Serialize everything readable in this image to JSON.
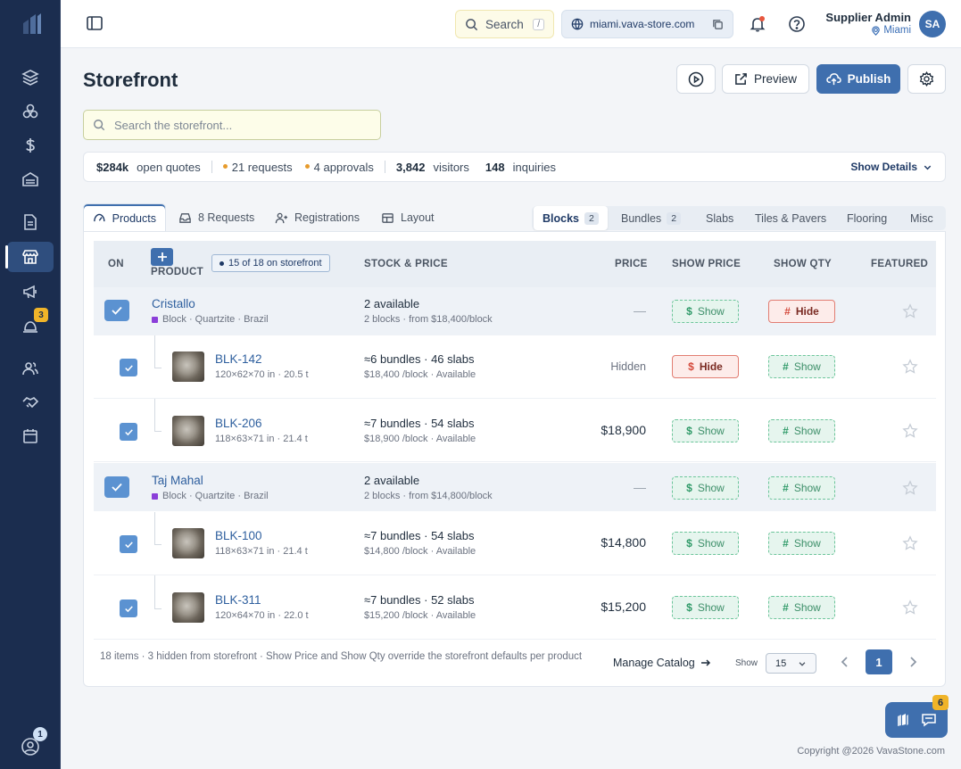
{
  "topbar": {
    "search_label": "Search",
    "search_shortcut": "/",
    "store_url": "miami.vava-store.com",
    "user_name": "Supplier Admin",
    "user_location": "Miami",
    "avatar_initials": "SA"
  },
  "sidebar": {
    "badge_campaigns": "3",
    "badge_profile": "1",
    "items": [
      "layers-icon",
      "boxes-icon",
      "dollar-icon",
      "warehouse-icon",
      "document-icon",
      "storefront-icon",
      "megaphone-icon",
      "bell-desk-icon",
      "users-icon",
      "handshake-icon",
      "calendar-icon"
    ]
  },
  "page": {
    "title": "Storefront",
    "preview_label": "Preview",
    "publish_label": "Publish",
    "search_placeholder": "Search the storefront..."
  },
  "stats": {
    "open_quotes_value": "$284k",
    "open_quotes_label": "open quotes",
    "requests": "21 requests",
    "approvals": "4 approvals",
    "visitors_value": "3,842",
    "visitors_label": "visitors",
    "inquiries_value": "148",
    "inquiries_label": "inquiries",
    "show_details": "Show Details"
  },
  "tabs": {
    "products": "Products",
    "requests": "8 Requests",
    "registrations": "Registrations",
    "layout": "Layout"
  },
  "subtabs": {
    "blocks": "Blocks",
    "blocks_count": "2",
    "bundles": "Bundles",
    "bundles_count": "2",
    "slabs": "Slabs",
    "tiles": "Tiles & Pavers",
    "flooring": "Flooring",
    "misc": "Misc"
  },
  "table": {
    "headers": {
      "on": "ON",
      "product": "PRODUCT",
      "on_storefront": "15 of 18 on storefront",
      "stock": "STOCK & PRICE",
      "price": "PRICE",
      "show_price": "SHOW PRICE",
      "show_qty": "SHOW QTY",
      "featured": "FEATURED"
    },
    "rows": [
      {
        "type": "parent",
        "name": "Cristallo",
        "meta": "Block · Quartzite · Brazil",
        "stock": "2 available",
        "stock_sub": "2 blocks · from $18,400/block",
        "price": "—",
        "show_price": "Show",
        "show_qty": "Hide"
      },
      {
        "type": "child",
        "name": "BLK-142",
        "dims": "120×62×70 in · 20.5 t",
        "stock": "≈6 bundles · 46 slabs",
        "stock_sub": "$18,400 /block · Available",
        "price": "Hidden",
        "show_price": "Hide",
        "show_qty": "Show"
      },
      {
        "type": "child",
        "name": "BLK-206",
        "dims": "118×63×71 in · 21.4 t",
        "stock": "≈7 bundles · 54 slabs",
        "stock_sub": "$18,900 /block · Available",
        "price": "$18,900",
        "show_price": "Show",
        "show_qty": "Show"
      },
      {
        "type": "parent",
        "name": "Taj Mahal",
        "meta": "Block · Quartzite · Brazil",
        "stock": "2 available",
        "stock_sub": "2 blocks · from $14,800/block",
        "price": "—",
        "show_price": "Show",
        "show_qty": "Show"
      },
      {
        "type": "child",
        "name": "BLK-100",
        "dims": "118×63×71 in · 21.4 t",
        "stock": "≈7 bundles · 54 slabs",
        "stock_sub": "$14,800 /block · Available",
        "price": "$14,800",
        "show_price": "Show",
        "show_qty": "Show"
      },
      {
        "type": "child",
        "name": "BLK-311",
        "dims": "120×64×70 in · 22.0 t",
        "stock": "≈7 bundles · 52 slabs",
        "stock_sub": "$15,200 /block · Available",
        "price": "$15,200",
        "show_price": "Show",
        "show_qty": "Show"
      }
    ]
  },
  "footer": {
    "note": "18 items · 3 hidden from storefront · Show Price and Show Qty override the storefront defaults per product",
    "manage_catalog": "Manage Catalog",
    "show_label": "Show",
    "page_size": "15",
    "current_page": "1"
  },
  "copyright": "Copyright @2026 VavaStone.com",
  "chat_badge": "6",
  "colors": {
    "sidebar": "#1b2d4f",
    "accent": "#3f6fae",
    "show_green": "#3d8f69",
    "hide_red": "#d4493b",
    "badge": "#f0b429"
  }
}
